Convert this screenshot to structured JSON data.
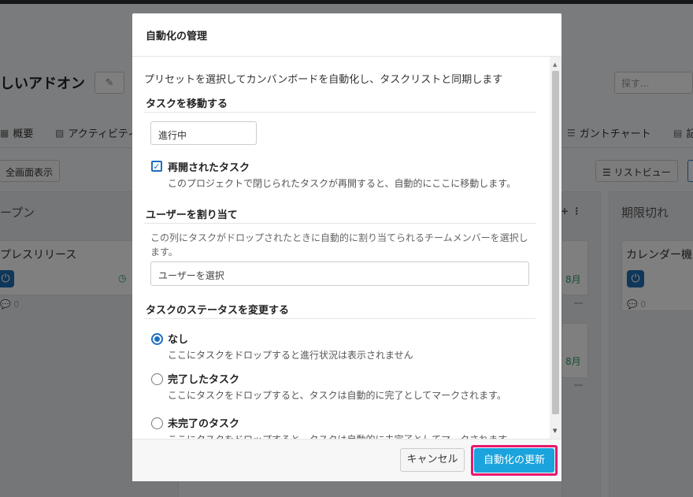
{
  "background": {
    "project_title": "しいアドオン",
    "search_placeholder": "探す...",
    "nav_tabs": [
      {
        "icon": "chart-icon",
        "label": "概要"
      },
      {
        "icon": "image-icon",
        "label": "アクティビティ"
      },
      {
        "icon": "gantt-icon",
        "label": "ガントチャート"
      },
      {
        "icon": "document-icon",
        "label": "記"
      }
    ],
    "fullscreen_label": "全画面表示",
    "list_view_label": "リストビュー",
    "columns": [
      {
        "title": "ープン",
        "card_title": "プレスリリース"
      },
      {
        "title": "期限切れ",
        "card_title": "カレンダー機"
      }
    ],
    "comment_count": "0",
    "date_badge": "8月"
  },
  "modal": {
    "title": "自動化の管理",
    "intro": "プリセットを選択してカンバンボードを自動化し、タスクリストと同期します",
    "move_section": {
      "heading": "タスクを移動する",
      "select_value": "進行中",
      "checkbox_label": "再開されたタスク",
      "checkbox_checked": true,
      "checkbox_desc": "このプロジェクトで閉じられたタスクが再開すると、自動的にここに移動します。"
    },
    "assign_section": {
      "heading": "ユーザーを割り当て",
      "help": "この列にタスクがドロップされたときに自動的に割り当てられるチームメンバーを選択します。",
      "input_placeholder": "ユーザーを選択"
    },
    "status_section": {
      "heading": "タスクのステータスを変更する",
      "options": [
        {
          "label": "なし",
          "desc": "ここにタスクをドロップすると進行状況は表示されません",
          "checked": true
        },
        {
          "label": "完了したタスク",
          "desc": "ここにタスクをドロップすると、タスクは自動的に完了としてマークされます。",
          "checked": false
        },
        {
          "label": "未完了のタスク",
          "desc": "ここにタスクをドロップすると、タスクは自動的に未完了としてマークされます。",
          "checked": false
        }
      ]
    },
    "footer": {
      "cancel_label": "キャンセル",
      "update_label": "自動化の更新"
    },
    "colors": {
      "primary": "#1aa3dc",
      "highlight": "#e8186b",
      "check": "#1e6ec0"
    }
  }
}
